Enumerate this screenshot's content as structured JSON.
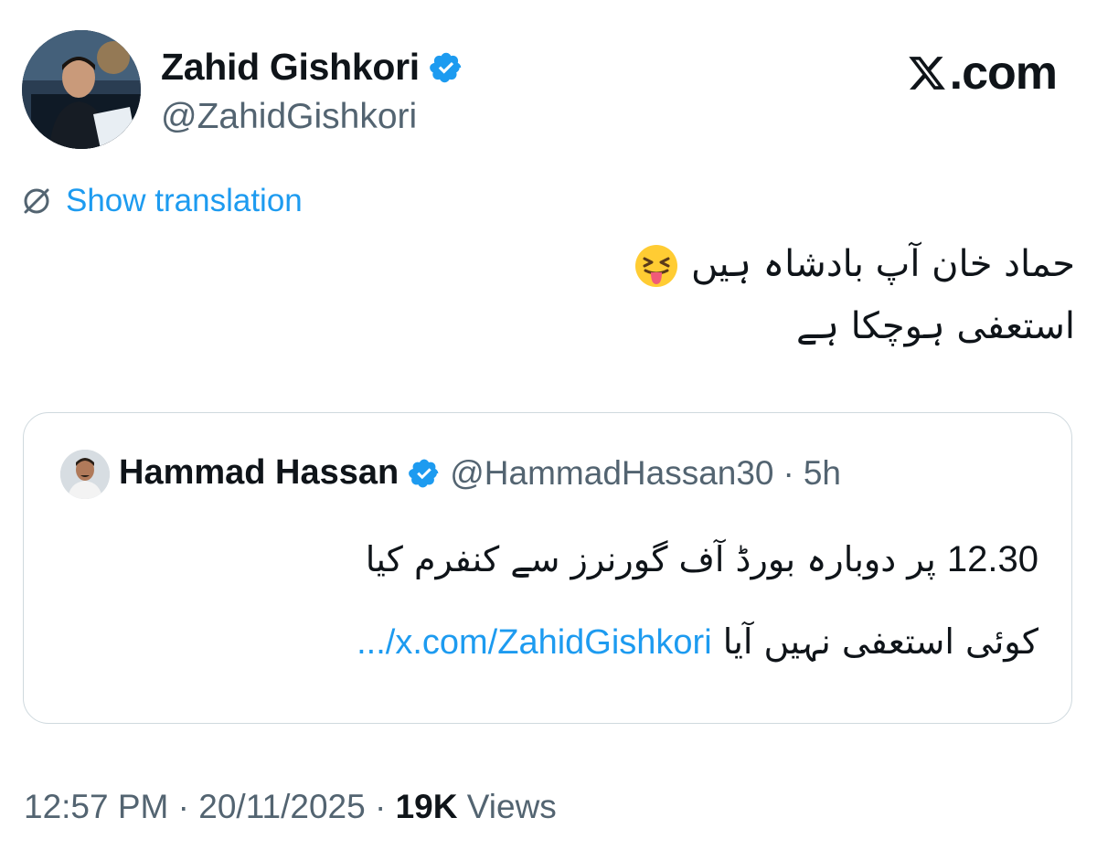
{
  "author": {
    "name": "Zahid Gishkori",
    "handle": "@ZahidGishkori",
    "verified": true
  },
  "brand": {
    "logo_text": ".com",
    "logo_icon": "x-logo-icon"
  },
  "translate": {
    "icon": "globe-slash-icon",
    "label": "Show translation"
  },
  "tweet": {
    "line1": "حماد خان آپ بادشاہ ہیں",
    "line2": "استعفی ہوچکا ہے",
    "emoji": "squinting-face-with-tongue"
  },
  "quote": {
    "name": "Hammad Hassan",
    "verified": true,
    "handle": "@HammadHassan30",
    "separator": "·",
    "time": "5h",
    "line1_number": "12.30",
    "line1_text": "پر دوبارہ بورڈ آف گورنرز سے کنفرم کیا",
    "line2_text": "کوئی استعفی نہیں آیا",
    "line2_link": ".../x.com/ZahidGishkori"
  },
  "meta": {
    "time": "12:57 PM",
    "date": "20/11/2025",
    "separator": "·",
    "views_count": "19K",
    "views_label": "Views"
  },
  "colors": {
    "accent": "#1d9bf0",
    "text": "#0f1419",
    "secondary": "#536471",
    "border": "#cfd9de"
  }
}
